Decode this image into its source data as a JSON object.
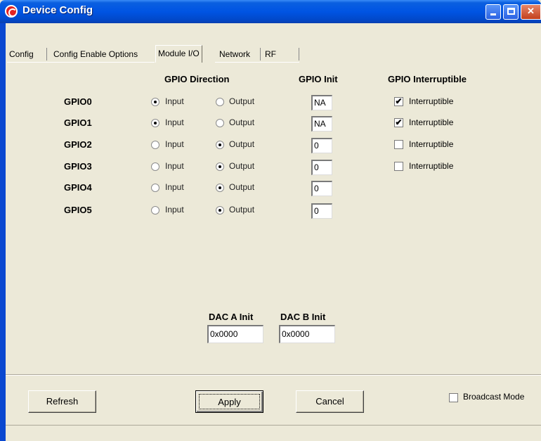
{
  "window": {
    "title": "Device Config"
  },
  "tabs": [
    {
      "label": "Config"
    },
    {
      "label": "Config Enable Options"
    },
    {
      "label": "Module I/O"
    },
    {
      "label": "Network"
    },
    {
      "label": "RF"
    }
  ],
  "headers": {
    "direction": "GPIO Direction",
    "init": "GPIO Init",
    "interruptible": "GPIO Interruptible"
  },
  "gpio_rows": [
    {
      "name": "GPIO0",
      "direction": "Input",
      "init": "NA",
      "interruptible_visible": true,
      "interruptible": true
    },
    {
      "name": "GPIO1",
      "direction": "Input",
      "init": "NA",
      "interruptible_visible": true,
      "interruptible": true
    },
    {
      "name": "GPIO2",
      "direction": "Output",
      "init": "0",
      "interruptible_visible": true,
      "interruptible": false
    },
    {
      "name": "GPIO3",
      "direction": "Output",
      "init": "0",
      "interruptible_visible": true,
      "interruptible": false
    },
    {
      "name": "GPIO4",
      "direction": "Output",
      "init": "0",
      "interruptible_visible": false,
      "interruptible": false
    },
    {
      "name": "GPIO5",
      "direction": "Output",
      "init": "0",
      "interruptible_visible": false,
      "interruptible": false
    }
  ],
  "option_labels": {
    "input": "Input",
    "output": "Output",
    "interruptible": "Interruptible"
  },
  "dac": {
    "a_label": "DAC A Init",
    "a_value": "0x0000",
    "b_label": "DAC B Init",
    "b_value": "0x0000"
  },
  "buttons": {
    "refresh": "Refresh",
    "apply": "Apply",
    "cancel": "Cancel"
  },
  "broadcast": {
    "label": "Broadcast Mode",
    "checked": false
  },
  "icons": {
    "app": "app-logo-icon",
    "minimize": "minimize-icon",
    "maximize": "maximize-icon",
    "close": "close-icon"
  },
  "colors": {
    "titlebar": "#0054e3",
    "window_bg": "#ece9d8",
    "close_button": "#c3401c"
  }
}
